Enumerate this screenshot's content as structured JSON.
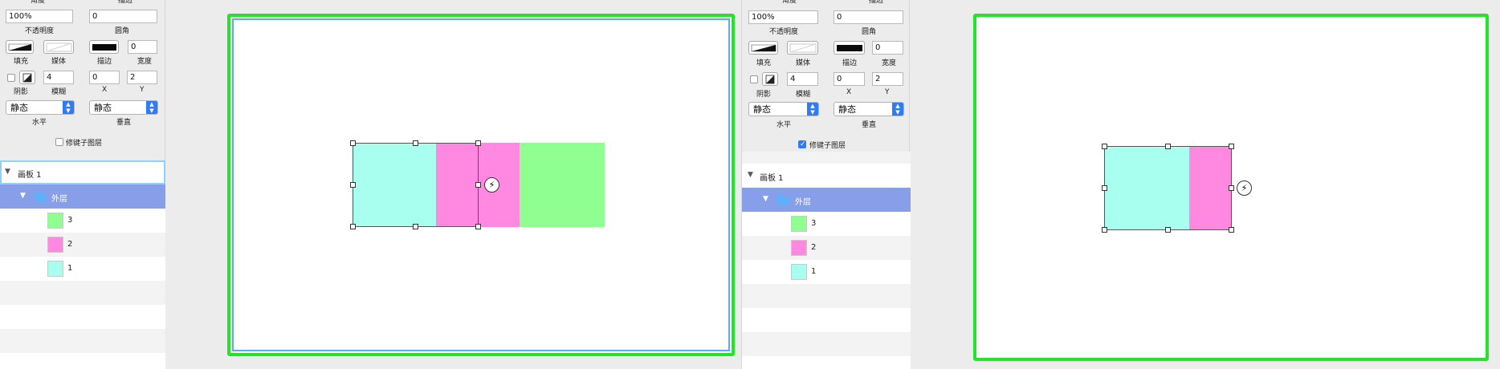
{
  "colors": {
    "panel_bg": "#ececec",
    "row_selected": "#879fe8",
    "artboard_border_green": "#22e52a",
    "artboard_border_blue": "#5aa8ff",
    "accent_blue": "#2f7bf6",
    "layer_1_cyan": "#a8fff0",
    "layer_2_pink": "#ff88e0",
    "layer_3_green": "#90ff92"
  },
  "inspector": {
    "width_label": "角度",
    "radius_label": "圆角",
    "opacity_value": "100%",
    "opacity_label": "不透明度",
    "angle_value": "0",
    "fill_label": "填充",
    "media_label": "媒体",
    "stroke_label": "描边",
    "stroke_width_value": "0",
    "stroke_width_label": "宽度",
    "shadow_label": "阴影",
    "blur_value": "4",
    "blur_label": "模糊",
    "x_value": "0",
    "x_label": "X",
    "y_value": "2",
    "y_label": "Y",
    "horizontal_select": "静态",
    "horizontal_label": "水平",
    "vertical_select": "静态",
    "vertical_label": "垂直",
    "mod_key_label": "修键子图层"
  },
  "layers": {
    "artboard": "画板 1",
    "group": "外层",
    "items": [
      "3",
      "2",
      "1"
    ]
  },
  "canvas": {
    "bolt_glyph": "⚡"
  }
}
